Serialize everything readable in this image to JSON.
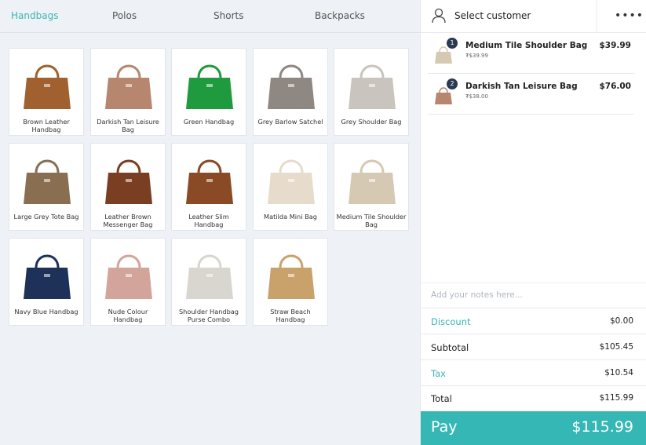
{
  "tabs": [
    {
      "label": "Handbags",
      "active": true
    },
    {
      "label": "Polos"
    },
    {
      "label": "Shorts"
    },
    {
      "label": "Backpacks"
    }
  ],
  "products": [
    {
      "name": "Brown Leather Handbag",
      "color": "#a0602f"
    },
    {
      "name": "Darkish Tan Leisure Bag",
      "color": "#b7866f"
    },
    {
      "name": "Green Handbag",
      "color": "#1f9a3e"
    },
    {
      "name": "Grey Barlow Satchel",
      "color": "#8e8782"
    },
    {
      "name": "Grey Shoulder Bag",
      "color": "#c9c4bd"
    },
    {
      "name": "Large Grey Tote Bag",
      "color": "#8a6e52"
    },
    {
      "name": "Leather Brown Messenger Bag",
      "color": "#7a3f23"
    },
    {
      "name": "Leather Slim Handbag",
      "color": "#8a4a26"
    },
    {
      "name": "Matilda Mini Bag",
      "color": "#e7dccb"
    },
    {
      "name": "Medium Tile Shoulder Bag",
      "color": "#d6c9b3"
    },
    {
      "name": "Navy Blue Handbag",
      "color": "#1e3158"
    },
    {
      "name": "Nude Colour Handbag",
      "color": "#d3a49a"
    },
    {
      "name": "Shoulder Handbag Purse Combo",
      "color": "#d9d6cf"
    },
    {
      "name": "Straw Beach Handbag",
      "color": "#c9a26b"
    }
  ],
  "customer": {
    "label": "Select customer",
    "more": "••••"
  },
  "order": [
    {
      "qty": "1",
      "name": "Medium Tile Shoulder Bag",
      "unit": "₮$39.99",
      "price": "$39.99",
      "color": "#d6c9b3"
    },
    {
      "qty": "2",
      "name": "Darkish Tan Leisure Bag",
      "unit": "₮$38.00",
      "price": "$76.00",
      "color": "#b7866f"
    }
  ],
  "notes": {
    "placeholder": "Add your notes here..."
  },
  "summary": {
    "discount_label": "Discount",
    "discount": "$0.00",
    "subtotal_label": "Subtotal",
    "subtotal": "$105.45",
    "tax_label": "Tax",
    "tax": "$10.54",
    "total_label": "Total",
    "total": "$115.99"
  },
  "pay": {
    "label": "Pay",
    "amount": "$115.99"
  },
  "colors": {
    "accent": "#35b8b5",
    "badge": "#2a3a52"
  }
}
